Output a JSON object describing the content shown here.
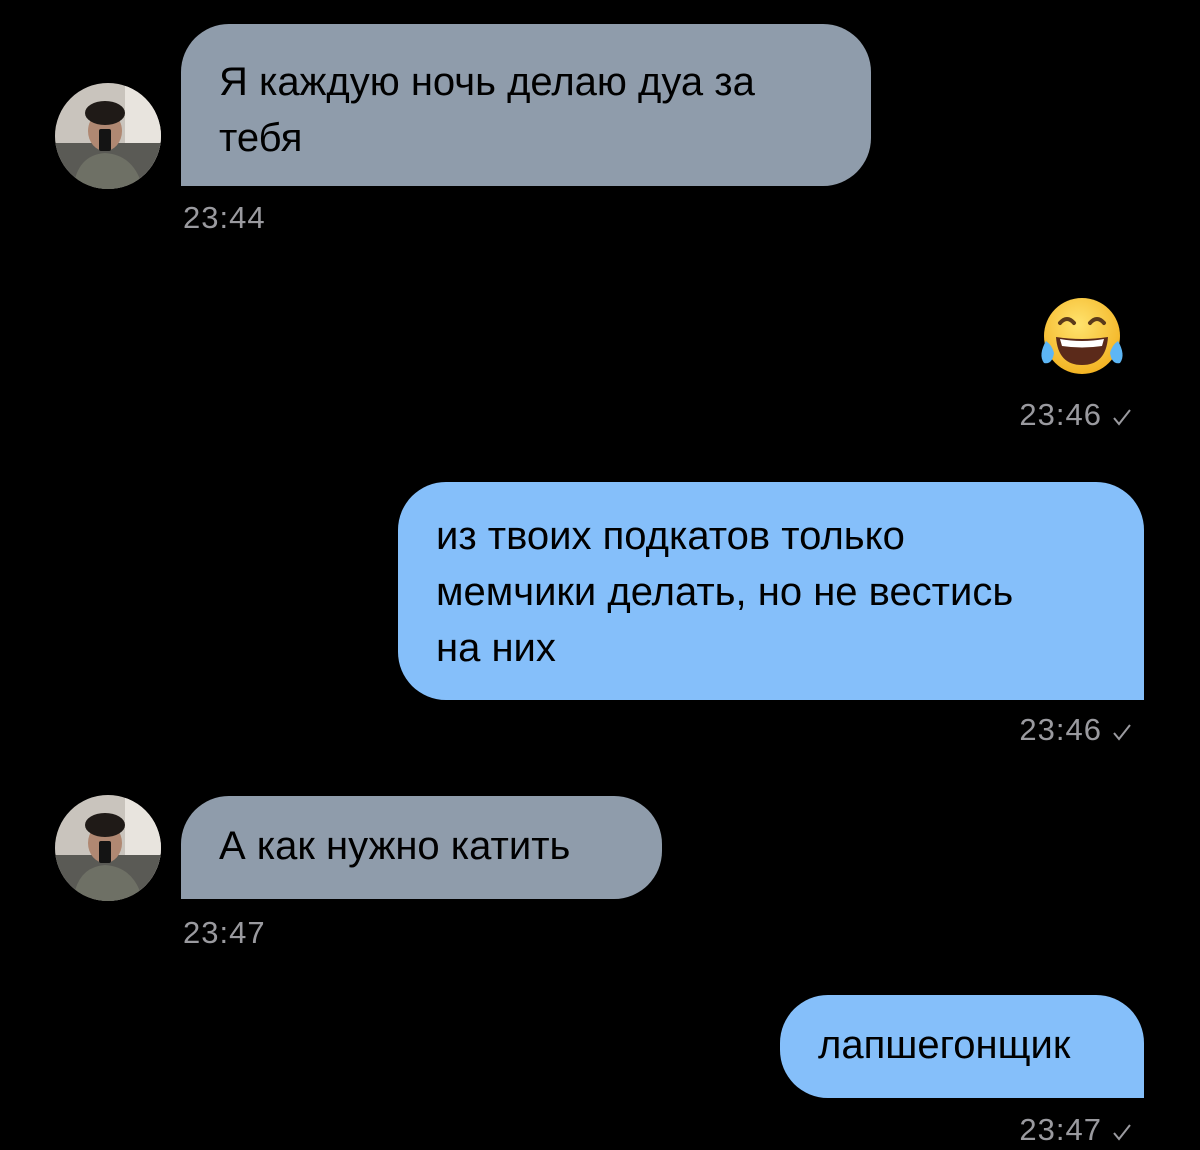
{
  "messages": [
    {
      "from": "contact",
      "text": "Я каждую ночь делаю дуа за\nтебя",
      "time": "23:44"
    },
    {
      "from": "me",
      "emoji": "face-with-tears-of-joy",
      "time": "23:46",
      "status": "sent-check-icon"
    },
    {
      "from": "me",
      "text": "из твоих подкатов только\nмемчики делать, но не вестись\nна них",
      "time": "23:46",
      "status": "sent-check-icon"
    },
    {
      "from": "contact",
      "text": "А как нужно катить",
      "time": "23:47"
    },
    {
      "from": "me",
      "text": "лапшегонщик",
      "time": "23:47",
      "status": "sent-check-icon"
    }
  ],
  "colors": {
    "background": "#000000",
    "incoming_bubble": "#8f9cab",
    "outgoing_bubble": "#85bffa",
    "timestamp": "#9a9a9f"
  }
}
